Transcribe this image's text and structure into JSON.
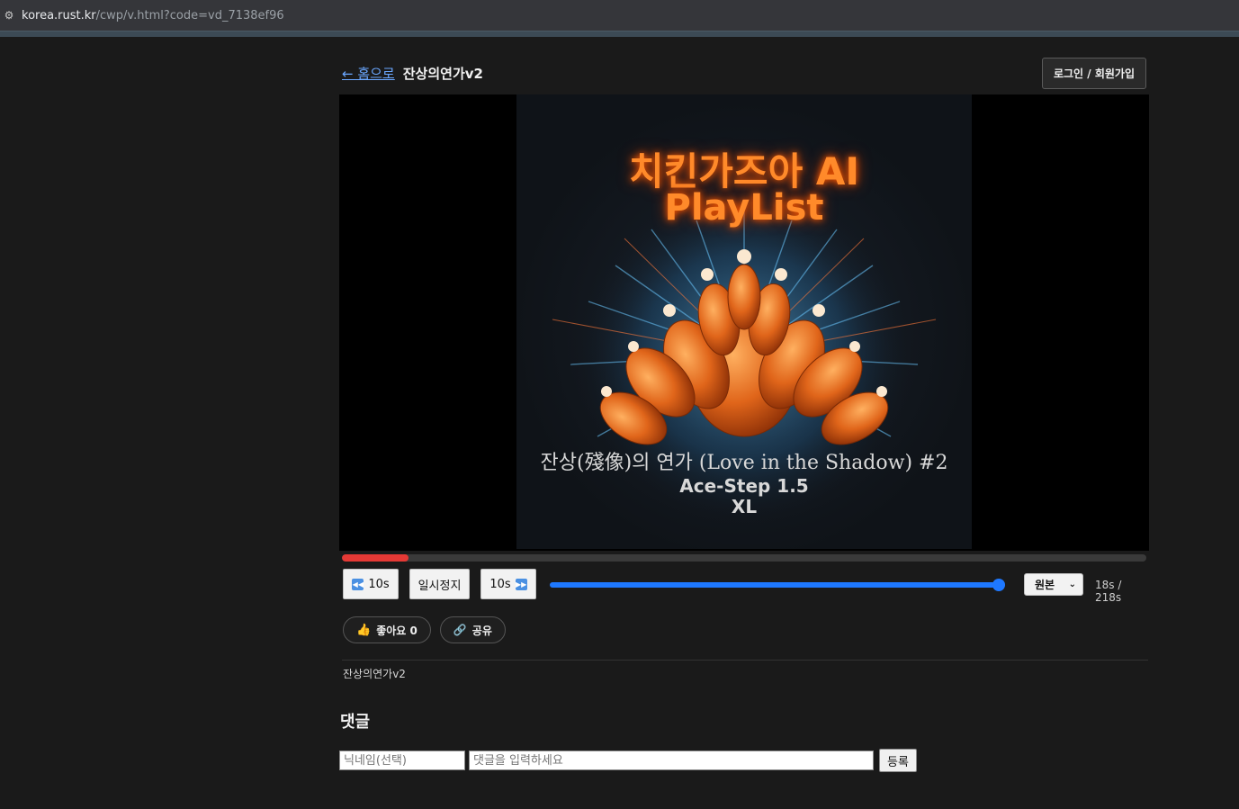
{
  "browser": {
    "url_host": "korea.rust.kr",
    "url_path": "/cwp/v.html?code=vd_7138ef96"
  },
  "header": {
    "back_label": "← 홈으로",
    "title": "잔상의연가v2",
    "login_label": "로그인 / 회원가입"
  },
  "cover": {
    "title_line1": "치킨가즈아 AI",
    "title_line2": "PlayList",
    "subtitle": "잔상(殘像)의 연가 (Love in the Shadow) #2",
    "model_line1": "Ace-Step 1.5",
    "model_line2": "XL"
  },
  "player": {
    "progress_fraction": 0.083,
    "volume_fraction": 1.0,
    "rewind_label": "10s",
    "pause_label": "일시정지",
    "forward_label": "10s",
    "quality_label": "원본",
    "time_text": "18s / 218s"
  },
  "social": {
    "like_label": "좋아요 0",
    "share_label": "공유"
  },
  "description": "잔상의연가v2",
  "comments": {
    "heading": "댓글",
    "nickname_placeholder": "닉네임(선택)",
    "comment_placeholder": "댓글을 입력하세요",
    "submit_label": "등록"
  },
  "colors": {
    "progress": "#e53935",
    "volume": "#1e78ff",
    "link": "#6aa7ff",
    "cover_title": "#ff8a2a"
  }
}
